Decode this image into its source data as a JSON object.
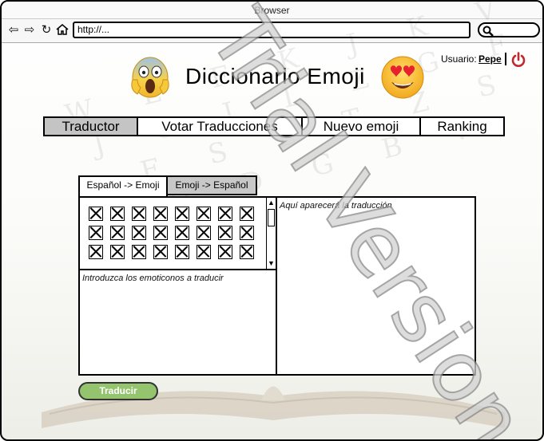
{
  "browser": {
    "title": "Browser",
    "url": "http://..."
  },
  "header": {
    "app_title": "Diccionario Emoji",
    "user_label": "Usuario:",
    "user_name": "Pepe"
  },
  "menu": {
    "items": [
      {
        "label": "Traductor",
        "active": true
      },
      {
        "label": "Votar Traducciones",
        "active": false
      },
      {
        "label": "Nuevo emoji",
        "active": false
      },
      {
        "label": "Ranking",
        "active": false
      }
    ]
  },
  "tabs": [
    {
      "label": "Español -> Emoji",
      "active": true
    },
    {
      "label": "Emoji -> Español",
      "active": false
    }
  ],
  "translator": {
    "input_placeholder": "Introduzca los emoticonos a traducir",
    "output_placeholder": "Aquí aparecerá la traducción",
    "translate_button": "Traducir"
  },
  "watermark": "Trial Version",
  "colors": {
    "active_menu": "#c4c4c4",
    "button_green": "#94c46e",
    "power_icon": "#c0282d"
  }
}
